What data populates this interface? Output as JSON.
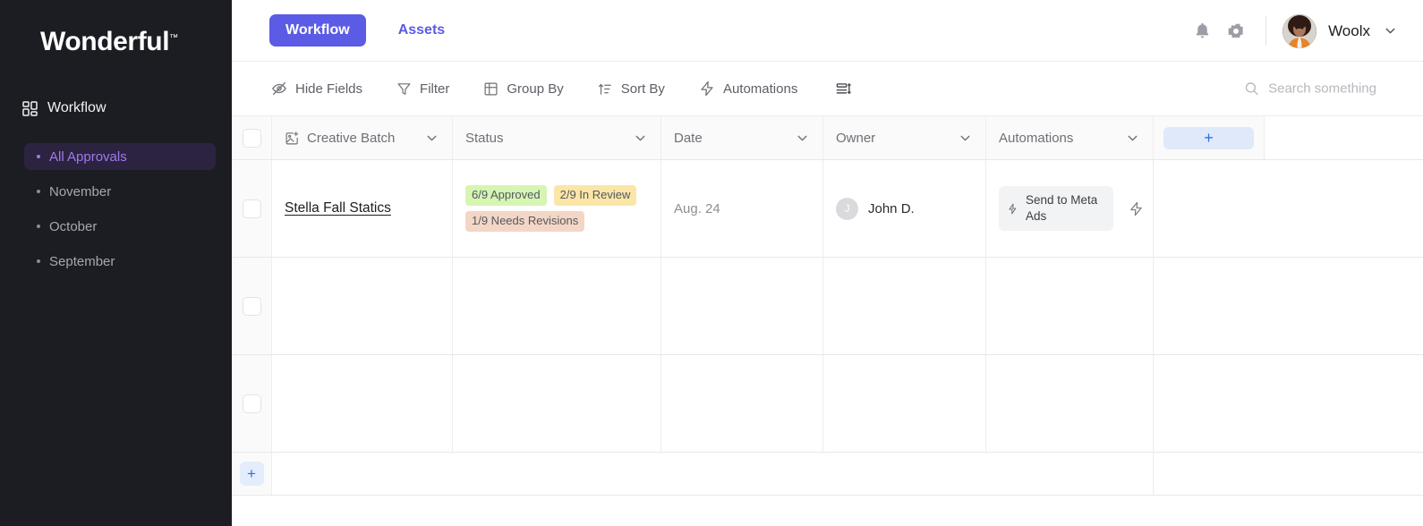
{
  "sidebar": {
    "brand": "Wonderful",
    "brand_tm": "™",
    "section": {
      "icon": "grid-icon",
      "label": "Workflow"
    },
    "items": [
      {
        "label": "All Approvals",
        "active": true
      },
      {
        "label": "November",
        "active": false
      },
      {
        "label": "October",
        "active": false
      },
      {
        "label": "September",
        "active": false
      }
    ],
    "bg": "#1b1d23",
    "active_bg": "#2c2341",
    "active_fg": "#9d7bec"
  },
  "topbar": {
    "tabs": [
      {
        "label": "Workflow",
        "active": true
      },
      {
        "label": "Assets",
        "active": false
      }
    ],
    "accent": "#5b5be6",
    "bell_icon": "bell-icon",
    "settings_icon": "gear-icon",
    "user": {
      "name": "Woolx",
      "avatar_icon": "user-avatar",
      "caret_icon": "chevron-down-icon"
    }
  },
  "toolbar": {
    "items": [
      {
        "label": "Hide Fields",
        "icon": "eye-off-icon"
      },
      {
        "label": "Filter",
        "icon": "funnel-icon"
      },
      {
        "label": "Group By",
        "icon": "table-grid-icon"
      },
      {
        "label": "Sort By",
        "icon": "sort-asc-icon"
      },
      {
        "label": "Automations",
        "icon": "lightning-icon"
      }
    ],
    "row_height_icon": "row-height-icon",
    "search": {
      "placeholder": "Search something",
      "icon": "search-icon",
      "value": ""
    }
  },
  "table": {
    "select_all": {
      "checked": false
    },
    "columns": [
      {
        "label": "Creative Batch",
        "icon": "image-plus-icon",
        "menu_icon": "chevron-down-icon"
      },
      {
        "label": "Status",
        "menu_icon": "chevron-down-icon"
      },
      {
        "label": "Date",
        "menu_icon": "chevron-down-icon"
      },
      {
        "label": "Owner",
        "menu_icon": "chevron-down-icon"
      },
      {
        "label": "Automations",
        "menu_icon": "chevron-down-icon"
      }
    ],
    "add_column_label": "+",
    "add_row_label": "+",
    "rows": [
      {
        "checked": false,
        "creative_batch": "Stella Fall Statics",
        "status_badges": [
          {
            "text": "6/9 Approved",
            "color": "#d6f5b3",
            "variant": "b-green"
          },
          {
            "text": "2/9 In Review",
            "color": "#fbe6a8",
            "variant": "b-yellow"
          },
          {
            "text": "1/9 Needs Revisions",
            "color": "#f4d6c6",
            "variant": "b-salmon"
          }
        ],
        "date": "Aug. 24",
        "owner": {
          "initial": "J",
          "name": "John D."
        },
        "automation": {
          "label": "Send to Meta Ads",
          "icon": "automation-plug-icon",
          "action_icon": "lightning-icon"
        }
      },
      {
        "checked": false,
        "creative_batch": "",
        "status_badges": [],
        "date": "",
        "owner": null,
        "automation": null
      },
      {
        "checked": false,
        "creative_batch": "",
        "status_badges": [],
        "date": "",
        "owner": null,
        "automation": null
      }
    ]
  }
}
